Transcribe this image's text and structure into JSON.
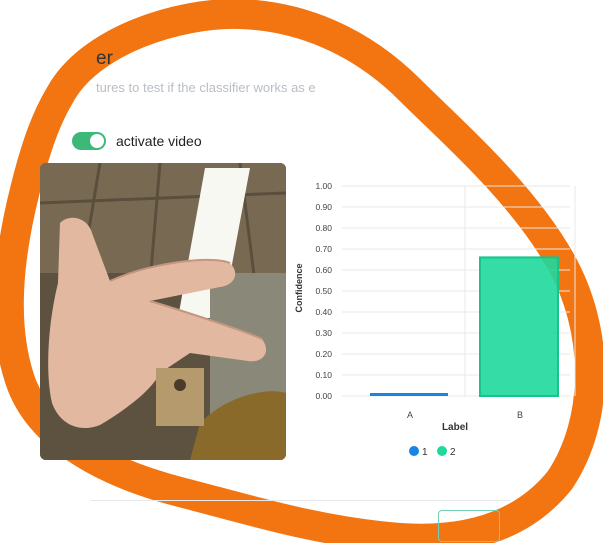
{
  "header": {
    "title": "er",
    "subtitle": "tures to test if the classifier works as e"
  },
  "video_toggle": {
    "label": "activate video",
    "state": "on",
    "color": "#3cb878"
  },
  "colors": {
    "blob": "#f37511",
    "series_1": "#1a84e5",
    "series_2": "#1fd89c"
  },
  "chart_data": {
    "type": "bar",
    "categories": [
      "A",
      "B"
    ],
    "series": [
      {
        "name": "1",
        "values": [
          0.0,
          0.0
        ]
      },
      {
        "name": "2",
        "values": [
          0.0,
          0.66
        ]
      }
    ],
    "ylabel": "Confidence",
    "xlabel": "Label",
    "ylim": [
      0,
      1.0
    ],
    "yticks": [
      "0.00",
      "0.10",
      "0.20",
      "0.30",
      "0.40",
      "0.50",
      "0.60",
      "0.70",
      "0.80",
      "0.90",
      "1.00"
    ],
    "legend": [
      "1",
      "2"
    ],
    "legend_position": "bottom",
    "grid": true
  }
}
